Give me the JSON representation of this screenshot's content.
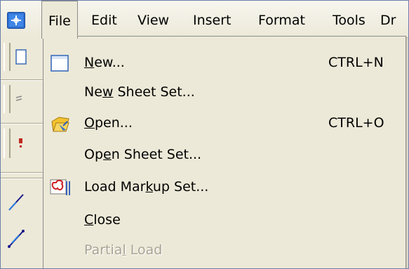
{
  "menubar": {
    "items": [
      {
        "label": "File"
      },
      {
        "label": "Edit"
      },
      {
        "label": "View"
      },
      {
        "label": "Insert"
      },
      {
        "label": "Format"
      },
      {
        "label": "Tools"
      },
      {
        "label": "Dr"
      }
    ]
  },
  "file_menu": {
    "items": [
      {
        "pre": "",
        "key": "N",
        "post": "ew...",
        "shortcut": "CTRL+N",
        "icon": "new-document-icon"
      },
      {
        "pre": "Ne",
        "key": "w",
        "post": " Sheet Set...",
        "shortcut": "",
        "icon": ""
      },
      {
        "pre": "",
        "key": "O",
        "post": "pen...",
        "shortcut": "CTRL+O",
        "icon": "open-folder-icon"
      },
      {
        "pre": "Op",
        "key": "e",
        "post": "n Sheet Set...",
        "shortcut": "",
        "icon": ""
      },
      {
        "pre": "Load Mar",
        "key": "k",
        "post": "up Set...",
        "shortcut": "",
        "icon": "markup-set-icon"
      },
      {
        "pre": "",
        "key": "C",
        "post": "lose",
        "shortcut": "",
        "icon": ""
      },
      {
        "pre": "Partia",
        "key": "l",
        "post": " Load",
        "shortcut": "",
        "icon": "",
        "disabled": true
      }
    ]
  },
  "colors": {
    "menu_background": "#ece9d8",
    "disabled_text": "#a8a497",
    "accent": "#1f5fbf"
  }
}
